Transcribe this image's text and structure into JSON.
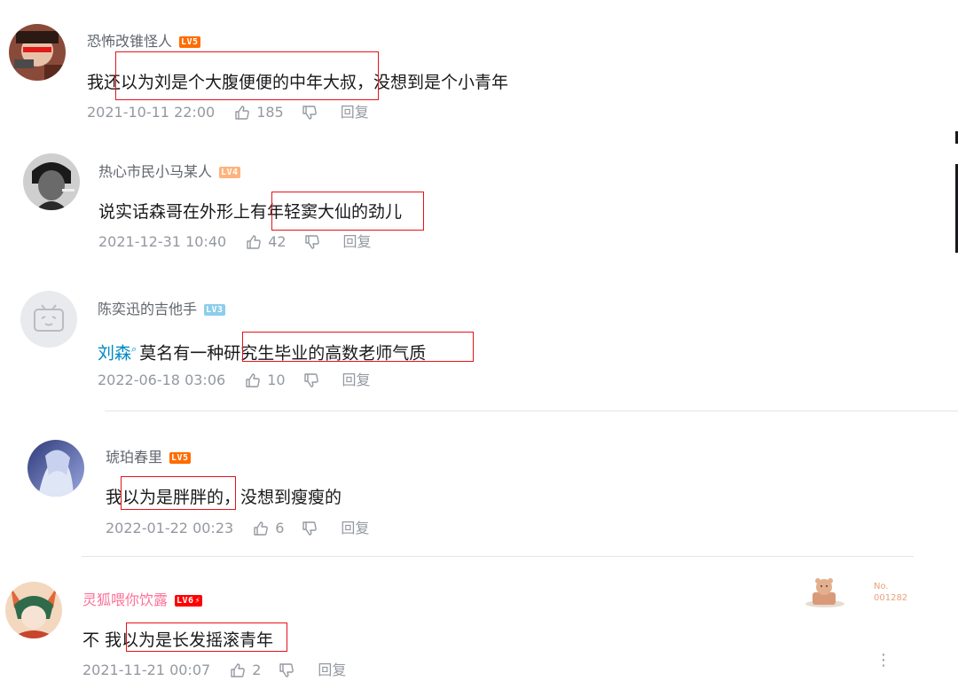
{
  "comments": [
    {
      "username": "恐怖改锥怪人",
      "level": "LV5",
      "text_before": "我还",
      "text_highlight": "以为刘是个大腹便便的中年大叔",
      "text_after": "，没想到是个小青年",
      "time": "2021-10-11 22:00",
      "likes": "185",
      "reply_label": "回复"
    },
    {
      "username": "热心市民小马某人",
      "level": "LV4",
      "text_before": "说实话森哥在外形上有",
      "text_highlight": "年轻窦大仙的劲儿",
      "text_after": "",
      "time": "2021-12-31 10:40",
      "likes": "42",
      "reply_label": "回复"
    },
    {
      "username": "陈奕迅的吉他手",
      "level": "LV3",
      "mention": "刘森",
      "text_before": "莫名有一种",
      "text_highlight": "研究生毕业的高数老师气质",
      "text_after": "",
      "time": "2022-06-18 03:06",
      "likes": "10",
      "reply_label": "回复"
    },
    {
      "username": "琥珀春里",
      "level": "LV5",
      "text_before": "我",
      "text_highlight": "以为是胖胖的",
      "text_after": "，没想到瘦瘦的",
      "time": "2022-01-22 00:23",
      "likes": "6",
      "reply_label": "回复"
    },
    {
      "username": "灵狐喂你饮露",
      "level": "LV6",
      "text_before": "不  我",
      "text_highlight": "以为是长发摇滚青年",
      "text_after": "",
      "time": "2021-11-21 00:07",
      "likes": "2",
      "reply_label": "回复",
      "medal_no_label": "No.",
      "medal_no": "001282"
    }
  ],
  "colors": {
    "highlight_box": "#e5131b",
    "mention": "#008ac5",
    "vip_name": "#fb7299",
    "meta_gray": "#9499a0"
  }
}
